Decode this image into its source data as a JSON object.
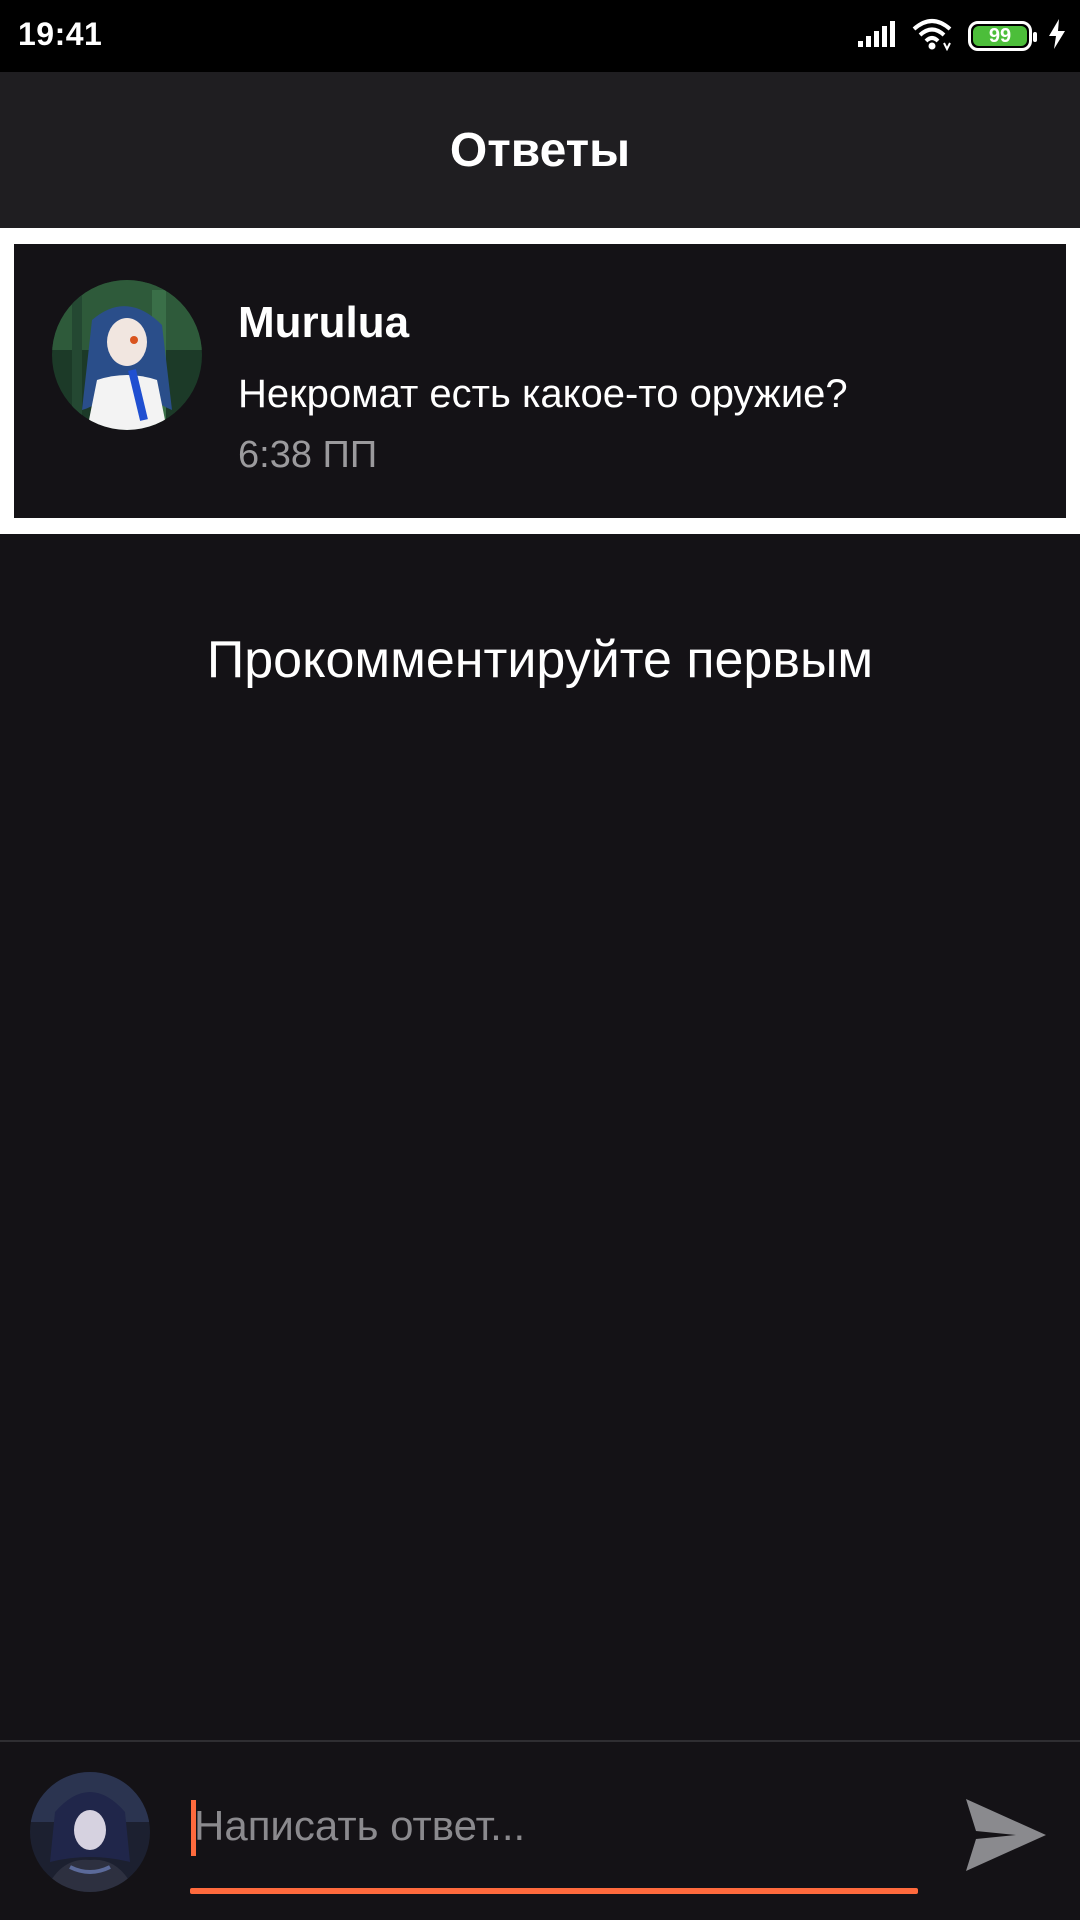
{
  "status_bar": {
    "time": "19:41",
    "battery_level": "99",
    "icons": [
      "signal-icon",
      "wifi-icon",
      "battery-icon",
      "charging-icon"
    ]
  },
  "header": {
    "title": "Ответы"
  },
  "thread": {
    "author": "Murulua",
    "message": "Некромат есть какое-то оружие?",
    "timestamp": "6:38 ПП"
  },
  "empty_state": {
    "text": "Прокомментируйте первым"
  },
  "reply": {
    "placeholder": "Написать ответ...",
    "value": ""
  },
  "colors": {
    "background": "#141216",
    "header": "#1f1e21",
    "accent": "#ff6a3d",
    "battery": "#4cbe3a",
    "muted_text": "#9b9a9d"
  }
}
